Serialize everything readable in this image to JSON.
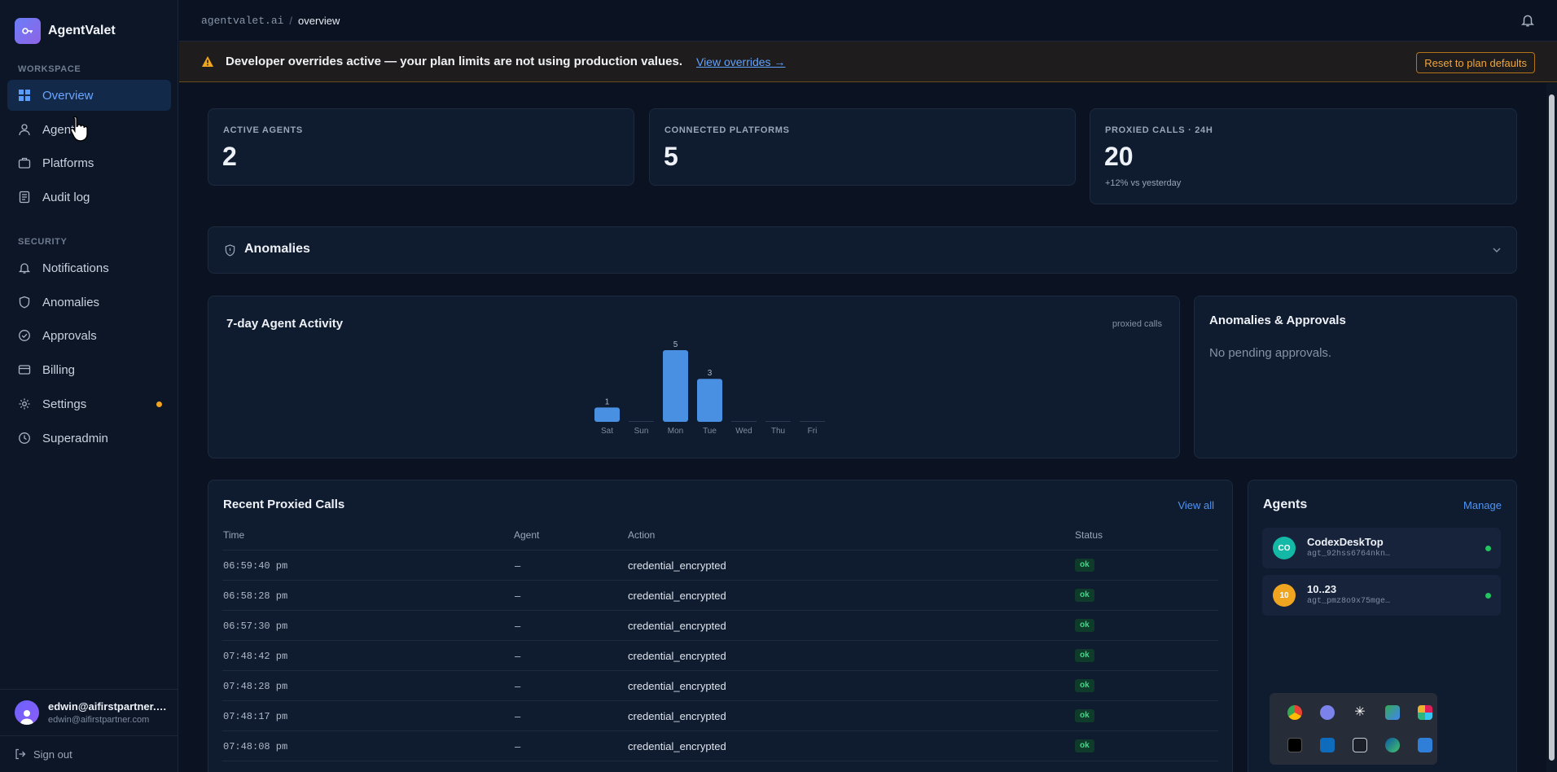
{
  "app": {
    "name": "AgentValet"
  },
  "sidebar": {
    "sections": [
      {
        "label": "WORKSPACE",
        "items": [
          {
            "label": "Overview",
            "icon": "grid-icon",
            "active": true
          },
          {
            "label": "Agents",
            "icon": "user-icon"
          },
          {
            "label": "Platforms",
            "icon": "briefcase-icon"
          },
          {
            "label": "Audit log",
            "icon": "document-icon"
          }
        ]
      },
      {
        "label": "SECURITY",
        "items": [
          {
            "label": "Notifications",
            "icon": "bell-icon"
          },
          {
            "label": "Anomalies",
            "icon": "shield-icon"
          },
          {
            "label": "Approvals",
            "icon": "check-circle-icon"
          },
          {
            "label": "Billing",
            "icon": "credit-card-icon"
          },
          {
            "label": "Settings",
            "icon": "gear-icon",
            "badge_color": "#f0a521"
          },
          {
            "label": "Superadmin",
            "icon": "clock-icon"
          }
        ]
      }
    ],
    "user": {
      "name": "edwin@aifirstpartner.com",
      "email": "edwin@aifirstpartner.com"
    },
    "signout": "Sign out"
  },
  "header": {
    "breadcrumb_root": "agentvalet.ai",
    "breadcrumb_sep": "/",
    "breadcrumb_current": "overview"
  },
  "banner": {
    "message": "Developer overrides active — your plan limits are not using production values.",
    "link": "View overrides →",
    "button": "Reset to plan defaults",
    "accent": "#f0a521"
  },
  "stats": [
    {
      "label": "ACTIVE AGENTS",
      "value": "2"
    },
    {
      "label": "CONNECTED PLATFORMS",
      "value": "5"
    },
    {
      "label": "PROXIED CALLS · 24H",
      "value": "20",
      "sub": "+12% vs yesterday"
    }
  ],
  "anomalies_panel": {
    "title": "Anomalies"
  },
  "activity": {
    "title": "7-day Agent Activity",
    "legend": "proxied calls"
  },
  "chart_data": {
    "type": "bar",
    "categories": [
      "Sat",
      "Sun",
      "Mon",
      "Tue",
      "Wed",
      "Thu",
      "Fri"
    ],
    "values": [
      1,
      0,
      5,
      3,
      0,
      0,
      0
    ],
    "labels": [
      "1",
      "",
      "5",
      "3",
      "",
      "",
      ""
    ],
    "color": "#4a90e2"
  },
  "approvals": {
    "title": "Anomalies & Approvals",
    "empty": "No pending approvals."
  },
  "recent": {
    "title": "Recent Proxied Calls",
    "view_all": "View all",
    "columns": [
      "Time",
      "Agent",
      "Action",
      "Status"
    ],
    "rows": [
      {
        "time": "06:59:40 pm",
        "agent": "–",
        "action": "credential_encrypted",
        "status": "ok"
      },
      {
        "time": "06:58:28 pm",
        "agent": "–",
        "action": "credential_encrypted",
        "status": "ok"
      },
      {
        "time": "06:57:30 pm",
        "agent": "–",
        "action": "credential_encrypted",
        "status": "ok"
      },
      {
        "time": "07:48:42 pm",
        "agent": "–",
        "action": "credential_encrypted",
        "status": "ok"
      },
      {
        "time": "07:48:28 pm",
        "agent": "–",
        "action": "credential_encrypted",
        "status": "ok"
      },
      {
        "time": "07:48:17 pm",
        "agent": "–",
        "action": "credential_encrypted",
        "status": "ok"
      },
      {
        "time": "07:48:08 pm",
        "agent": "–",
        "action": "credential_encrypted",
        "status": "ok"
      }
    ]
  },
  "agents": {
    "title": "Agents",
    "manage": "Manage",
    "items": [
      {
        "initials": "CO",
        "name": "CodexDeskTop",
        "id": "agt_92hss6764nkn…",
        "color": "#14b8a6",
        "status_color": "#22c55e"
      },
      {
        "initials": "10",
        "name": "10..23",
        "id": "agt_pmz8o9x75mge…",
        "color": "#f0a521",
        "status_color": "#22c55e"
      }
    ]
  },
  "tray": {
    "icons": [
      "chrome-icon",
      "chat-icon",
      "claude-icon",
      "drive-icon",
      "slack-icon",
      "amd-icon",
      "outlook-icon",
      "window-icon",
      "edge-icon",
      "security-icon"
    ]
  }
}
